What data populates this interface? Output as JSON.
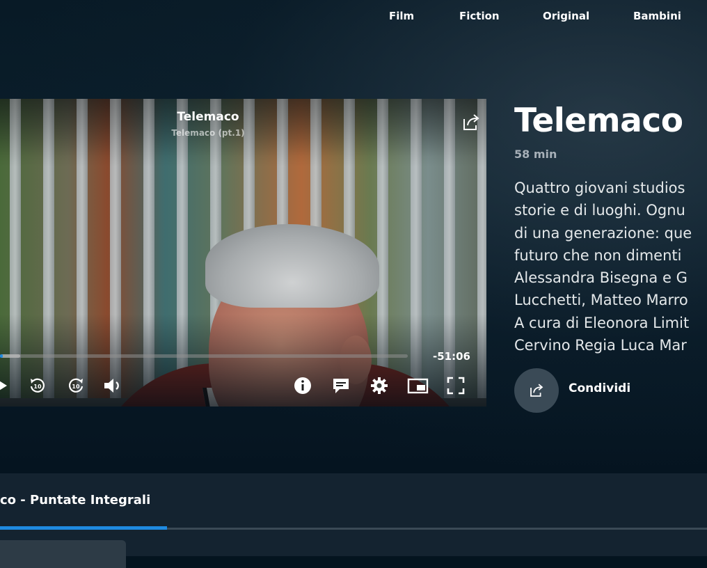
{
  "nav": {
    "items": [
      "Film",
      "Fiction",
      "Original",
      "Bambini"
    ]
  },
  "player": {
    "title": "Telemaco",
    "subtitle": "Telemaco (pt.1)",
    "time_remaining": "-51:06",
    "progress": 0.006,
    "buffered": 0.05,
    "controls": [
      "play-icon",
      "rewind-10-icon",
      "forward-10-icon",
      "volume-icon",
      "info-icon",
      "subtitles-icon",
      "settings-icon",
      "picture-in-picture-icon",
      "fullscreen-icon"
    ]
  },
  "details": {
    "title": "Telemaco",
    "duration": "58 min",
    "description_lines": [
      "Quattro giovani studios",
      "storie e di luoghi. Ognu",
      "di una generazione: que",
      "futuro che non dimenti",
      "Alessandra Bisegna e G",
      "Lucchetti, Matteo Marro",
      "A cura di Eleonora Limit",
      "Cervino Regia Luca Mar"
    ],
    "share_label": "Condividi"
  },
  "tabs": {
    "active_label": "co - Puntate Integrali"
  },
  "colors": {
    "accent": "#1f8ae0",
    "background": "#04141f",
    "panel": "#142330"
  }
}
